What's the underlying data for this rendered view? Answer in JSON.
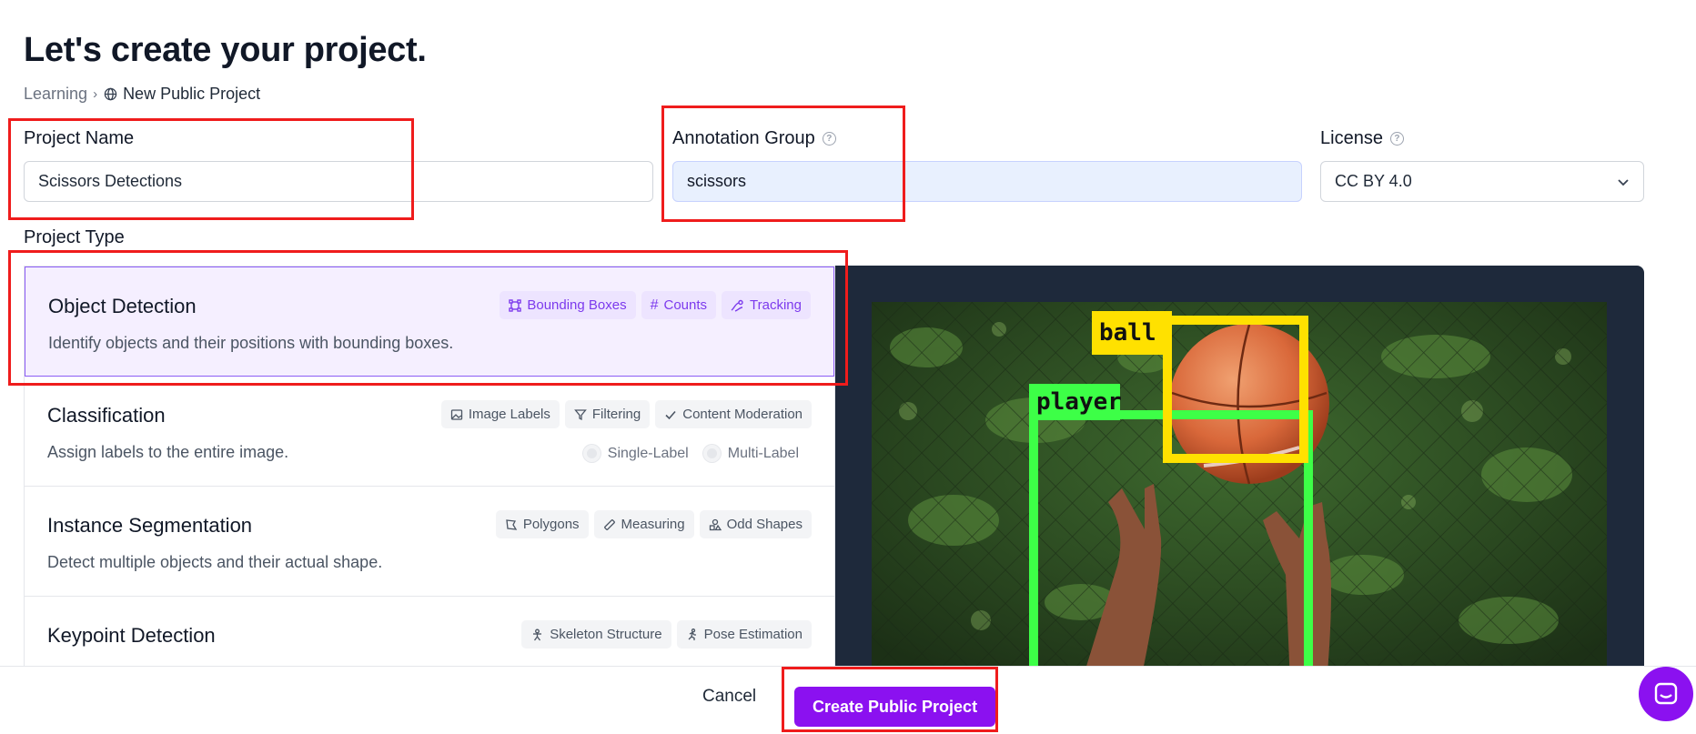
{
  "page": {
    "title": "Let's create your project."
  },
  "breadcrumb": {
    "parent": "Learning",
    "current": "New Public Project"
  },
  "form": {
    "project_name": {
      "label": "Project Name",
      "value": "Scissors Detections"
    },
    "annotation_group": {
      "label": "Annotation Group",
      "value": "scissors"
    },
    "license": {
      "label": "License",
      "value": "CC BY 4.0"
    },
    "project_type_label": "Project Type"
  },
  "project_types": [
    {
      "title": "Object Detection",
      "description": "Identify objects and their positions with bounding boxes.",
      "selected": true,
      "tags": [
        {
          "icon": "bounding-box-icon",
          "label": "Bounding Boxes"
        },
        {
          "icon": "hash-icon",
          "label": "Counts"
        },
        {
          "icon": "tracking-icon",
          "label": "Tracking"
        }
      ]
    },
    {
      "title": "Classification",
      "description": "Assign labels to the entire image.",
      "selected": false,
      "tags": [
        {
          "icon": "image-icon",
          "label": "Image Labels"
        },
        {
          "icon": "filter-icon",
          "label": "Filtering"
        },
        {
          "icon": "check-icon",
          "label": "Content Moderation"
        }
      ],
      "options": [
        "Single-Label",
        "Multi-Label"
      ]
    },
    {
      "title": "Instance Segmentation",
      "description": "Detect multiple objects and their actual shape.",
      "selected": false,
      "tags": [
        {
          "icon": "polygon-icon",
          "label": "Polygons"
        },
        {
          "icon": "ruler-icon",
          "label": "Measuring"
        },
        {
          "icon": "shapes-icon",
          "label": "Odd Shapes"
        }
      ]
    },
    {
      "title": "Keypoint Detection",
      "description": "",
      "selected": false,
      "tags": [
        {
          "icon": "skeleton-icon",
          "label": "Skeleton Structure"
        },
        {
          "icon": "running-person-icon",
          "label": "Pose Estimation"
        }
      ]
    }
  ],
  "preview": {
    "labels": [
      "ball",
      "player"
    ],
    "ball_color": "#ffe100",
    "player_color": "#3dff47"
  },
  "footer": {
    "cancel_label": "Cancel",
    "create_label": "Create Public Project"
  },
  "colors": {
    "accent": "#8b11f0",
    "selected_bg": "#f5efff",
    "highlight_box": "#ef1c1c"
  }
}
